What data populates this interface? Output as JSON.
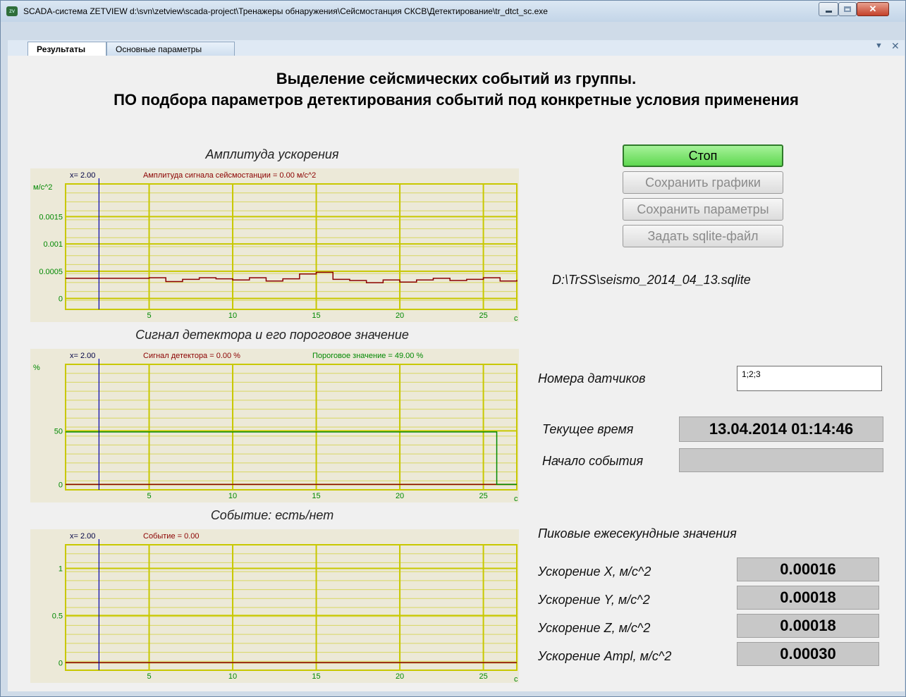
{
  "window": {
    "title": "SCADA-система ZETVIEW d:\\svn\\zetview\\scada-project\\Тренажеры обнаружения\\Сейсмостанция СКСВ\\Детектирование\\tr_dtct_sc.exe",
    "icon": "zetview-app-icon",
    "close_glyph": "✕"
  },
  "tabs": [
    {
      "label": "Результаты",
      "active": true
    },
    {
      "label": "Основные параметры",
      "active": false
    }
  ],
  "tab_menu_glyph": "▼",
  "tab_close_glyph": "✕",
  "header": {
    "line1": "Выделение сейсмических событий из группы.",
    "line2": "ПО подбора параметров детектирования событий под конкретные условия применения"
  },
  "buttons": {
    "stop": "Стоп",
    "save_charts": "Сохранить графики",
    "save_params": "Сохранить параметры",
    "set_sqlite": "Задать sqlite-файл"
  },
  "file_path": "D:\\TrSS\\seismo_2014_04_13.sqlite",
  "sensors": {
    "label": "Номера датчиков",
    "value": "1;2;3"
  },
  "current_time": {
    "label": "Текущее время",
    "value": "13.04.2014 01:14:46"
  },
  "event_start": {
    "label": "Начало события",
    "value": ""
  },
  "peaks": {
    "title": "Пиковые ежесекундные значения",
    "rows": [
      {
        "label": "Ускорение X, м/с^2",
        "value": "0.00016"
      },
      {
        "label": "Ускорение Y, м/с^2",
        "value": "0.00018"
      },
      {
        "label": "Ускорение Z, м/с^2",
        "value": "0.00018"
      },
      {
        "label": "Ускорение Ampl, м/с^2",
        "value": "0.00030"
      }
    ]
  },
  "colors": {
    "plot_bg": "#ece9d8",
    "grid": "#c8c800",
    "cursor": "#0000aa",
    "series_red": "#8b0000",
    "series_green": "#008800",
    "tick_green": "#008800"
  },
  "chart_data": [
    {
      "type": "line",
      "title": "Амплитуда ускорения",
      "ylabel": "м/с^2",
      "xunit": "с",
      "cursor_text": "x= 2.00",
      "cursor_x": 2,
      "xlim": [
        0,
        27
      ],
      "ylim": [
        -0.0002,
        0.0021
      ],
      "xticks": [
        5,
        10,
        15,
        20,
        25
      ],
      "yticks": [
        0,
        0.0005,
        0.001,
        0.0015
      ],
      "ytick_labels": [
        "0",
        "0.0005",
        "0.001",
        "0.0015"
      ],
      "series": [
        {
          "name": "Амплитуда сигнала сейсмостанции = 0.00 м/с^2",
          "color": "#8b0000",
          "step": true,
          "x": [
            0,
            1,
            2,
            3,
            4,
            5,
            6,
            7,
            8,
            9,
            10,
            11,
            12,
            13,
            14,
            15,
            16,
            17,
            18,
            19,
            20,
            21,
            22,
            23,
            24,
            25,
            26,
            27
          ],
          "y": [
            0.00037,
            0.00037,
            0.00037,
            0.00037,
            0.00037,
            0.00038,
            0.00031,
            0.00035,
            0.00038,
            0.00036,
            0.00034,
            0.00038,
            0.00032,
            0.00036,
            0.00045,
            0.00048,
            0.00035,
            0.00033,
            0.00029,
            0.00034,
            0.0003,
            0.00034,
            0.00037,
            0.00033,
            0.00035,
            0.00038,
            0.00032,
            0.00034
          ]
        }
      ]
    },
    {
      "type": "line",
      "title": "Сигнал детектора и его пороговое значение",
      "ylabel": "%",
      "xunit": "с",
      "cursor_text": "x= 2.00",
      "cursor_x": 2,
      "xlim": [
        0,
        27
      ],
      "ylim": [
        -5,
        112
      ],
      "xticks": [
        5,
        10,
        15,
        20,
        25
      ],
      "yticks": [
        0,
        50
      ],
      "ytick_labels": [
        "0",
        "50"
      ],
      "series": [
        {
          "name": "Сигнал детектора = 0.00 %",
          "color": "#8b0000",
          "step": true,
          "x": [
            0,
            27
          ],
          "y": [
            0,
            0
          ]
        },
        {
          "name": "Пороговое значение = 49.00 %",
          "color": "#008800",
          "step": true,
          "x": [
            0,
            25.8,
            25.8,
            27
          ],
          "y": [
            49,
            49,
            0,
            0
          ]
        }
      ]
    },
    {
      "type": "line",
      "title": "Событие: есть/нет",
      "ylabel": "",
      "xunit": "с",
      "cursor_text": "x= 2.00",
      "cursor_x": 2,
      "xlim": [
        0,
        27
      ],
      "ylim": [
        -0.08,
        1.25
      ],
      "xticks": [
        5,
        10,
        15,
        20,
        25
      ],
      "yticks": [
        0,
        0.5,
        1
      ],
      "ytick_labels": [
        "0",
        "0.5",
        "1"
      ],
      "series": [
        {
          "name": "Событие = 0.00",
          "color": "#8b0000",
          "step": true,
          "x": [
            0,
            27
          ],
          "y": [
            0,
            0
          ]
        }
      ]
    }
  ]
}
